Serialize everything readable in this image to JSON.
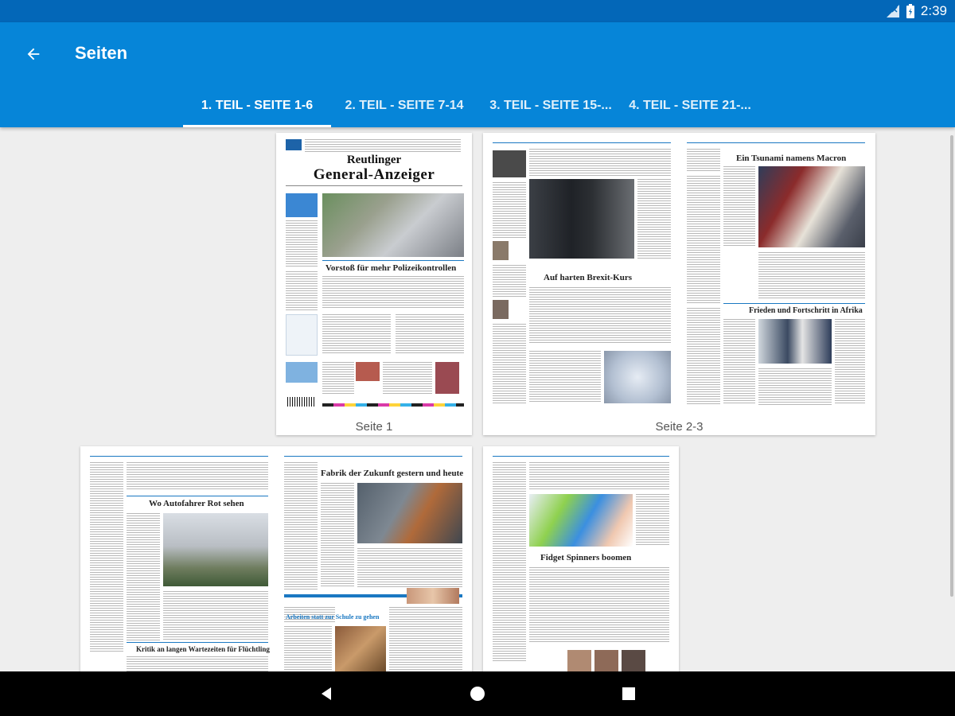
{
  "status_bar": {
    "time": "2:39",
    "icons": [
      "signal-icon",
      "battery-icon"
    ]
  },
  "app_bar": {
    "title": "Seiten",
    "back_icon": "arrow-back-icon",
    "tabs": [
      {
        "label": "1. TEIL - SEITE 1-6",
        "active": true
      },
      {
        "label": "2. TEIL - SEITE 7-14",
        "active": false
      },
      {
        "label": "3. TEIL - SEITE 15-...",
        "active": false
      },
      {
        "label": "4. TEIL - SEITE 21-...",
        "active": false
      }
    ]
  },
  "pages": [
    {
      "label": "Seite 1",
      "masthead_line1": "Reutlinger",
      "masthead_line2": "General-Anzeiger",
      "headlines": [
        "Vorstoß für mehr Polizeikontrollen"
      ]
    },
    {
      "label": "Seite 2-3",
      "headlines": [
        "Auf harten Brexit-Kurs",
        "Ein Tsunami namens Macron",
        "Frieden und Fortschritt in Afrika"
      ]
    },
    {
      "label": "",
      "headlines": [
        "Wo Autofahrer Rot sehen",
        "Fabrik der Zukunft gestern und heute",
        "Kritik an langen Wartezeiten für Flüchtlinge",
        "Arbeiten statt zur Schule zu gehen"
      ]
    },
    {
      "label": "",
      "headlines": [
        "Fidget Spinners boomen"
      ]
    }
  ],
  "colors": {
    "status_bar": "#0367b8",
    "app_bar": "#0685d8",
    "background": "#eeeeee",
    "nav_bar": "#000000"
  },
  "nav_bar": {
    "icons": [
      "back-triangle-icon",
      "home-circle-icon",
      "recents-square-icon"
    ]
  }
}
